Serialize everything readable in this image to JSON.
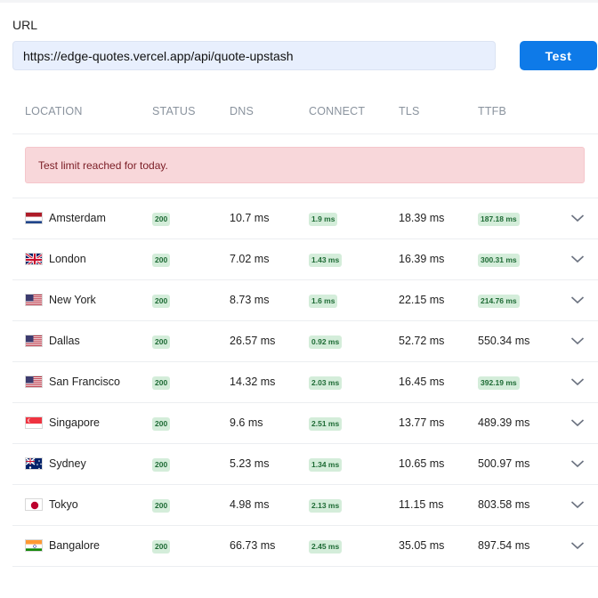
{
  "url_label": "URL",
  "url_value": "https://edge-quotes.vercel.app/api/quote-upstash",
  "test_button": "Test",
  "headers": {
    "location": "LOCATION",
    "status": "STATUS",
    "dns": "DNS",
    "connect": "CONNECT",
    "tls": "TLS",
    "ttfb": "TTFB"
  },
  "alert": "Test limit reached for today.",
  "rows": [
    {
      "location": "Amsterdam",
      "flag": "netherlands-flag-icon",
      "status": "200",
      "dns": "10.7 ms",
      "connect": "1.9 ms",
      "tls": "18.39 ms",
      "ttfb": "187.18 ms",
      "ttfb_badge": true
    },
    {
      "location": "London",
      "flag": "uk-flag-icon",
      "status": "200",
      "dns": "7.02 ms",
      "connect": "1.43 ms",
      "tls": "16.39 ms",
      "ttfb": "300.31 ms",
      "ttfb_badge": true
    },
    {
      "location": "New York",
      "flag": "us-flag-icon",
      "status": "200",
      "dns": "8.73 ms",
      "connect": "1.6 ms",
      "tls": "22.15 ms",
      "ttfb": "214.76 ms",
      "ttfb_badge": true
    },
    {
      "location": "Dallas",
      "flag": "us-flag-icon",
      "status": "200",
      "dns": "26.57 ms",
      "connect": "0.92 ms",
      "tls": "52.72 ms",
      "ttfb": "550.34 ms",
      "ttfb_badge": false
    },
    {
      "location": "San Francisco",
      "flag": "us-flag-icon",
      "status": "200",
      "dns": "14.32 ms",
      "connect": "2.03 ms",
      "tls": "16.45 ms",
      "ttfb": "392.19 ms",
      "ttfb_badge": true
    },
    {
      "location": "Singapore",
      "flag": "singapore-flag-icon",
      "status": "200",
      "dns": "9.6 ms",
      "connect": "2.51 ms",
      "tls": "13.77 ms",
      "ttfb": "489.39 ms",
      "ttfb_badge": false
    },
    {
      "location": "Sydney",
      "flag": "australia-flag-icon",
      "status": "200",
      "dns": "5.23 ms",
      "connect": "1.34 ms",
      "tls": "10.65 ms",
      "ttfb": "500.97 ms",
      "ttfb_badge": false
    },
    {
      "location": "Tokyo",
      "flag": "japan-flag-icon",
      "status": "200",
      "dns": "4.98 ms",
      "connect": "2.13 ms",
      "tls": "11.15 ms",
      "ttfb": "803.58 ms",
      "ttfb_badge": false
    },
    {
      "location": "Bangalore",
      "flag": "india-flag-icon",
      "status": "200",
      "dns": "66.73 ms",
      "connect": "2.45 ms",
      "tls": "35.05 ms",
      "ttfb": "897.54 ms",
      "ttfb_badge": false
    }
  ],
  "colors": {
    "accent": "#0e7ae8",
    "badge_bg": "#d4edda",
    "badge_text": "#1e6b35",
    "alert_bg": "#f8d7da",
    "alert_text": "#7a1c24"
  }
}
